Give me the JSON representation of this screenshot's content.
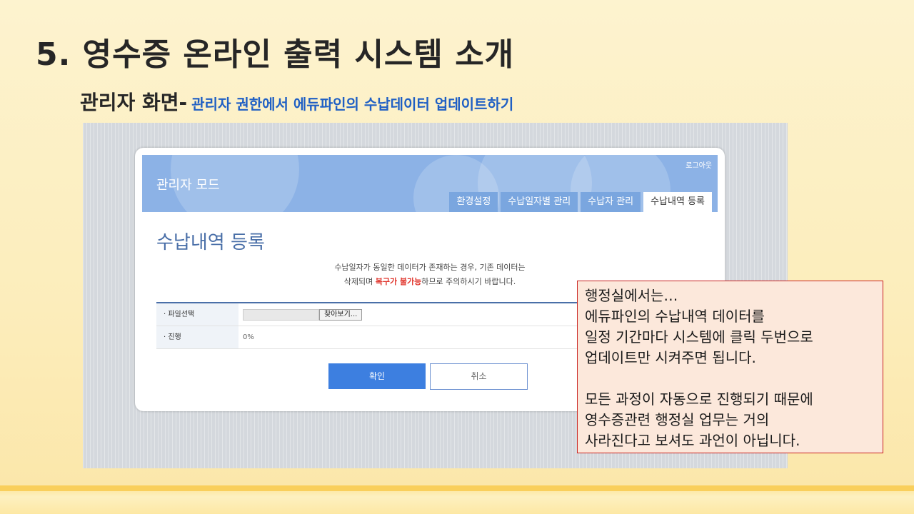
{
  "slide": {
    "title": "5. 영수증 온라인 출력 시스템 소개",
    "subtitle_lead": "관리자 화면-",
    "subtitle_desc": "관리자 권한에서 에듀파인의 수납데이터 업데이트하기"
  },
  "app": {
    "banner_title": "관리자 모드",
    "logout_label": "로그아웃",
    "tabs": [
      {
        "label": "환경설정",
        "active": false
      },
      {
        "label": "수납일자별 관리",
        "active": false
      },
      {
        "label": "수납자 관리",
        "active": false
      },
      {
        "label": "수납내역 등록",
        "active": true
      }
    ],
    "page_heading": "수납내역 등록",
    "notice": {
      "line1": "수납일자가 동일한 데이터가 존재하는 경우, 기존 데이터는",
      "line2_before": "삭제되며 ",
      "line2_highlight": "복구가 불가능",
      "line2_after": "하므로 주의하시기 바랍니다."
    },
    "form": {
      "file_label": "· 파일선택",
      "browse_button": "찾아보기...",
      "progress_label": "· 진행",
      "progress_value": "0%"
    },
    "confirm_button": "확인",
    "cancel_button": "취소"
  },
  "callout": {
    "lines": [
      "행정실에서는…",
      "에듀파인의 수납내역 데이터를",
      "일정 기간마다 시스템에 클릭 두번으로",
      "업데이트만 시켜주면 됩니다.",
      "",
      "모든 과정이 자동으로 진행되기 때문에",
      "영수증관련 행정실 업무는 거의",
      "사라진다고 보셔도 과언이 아닙니다."
    ]
  },
  "colors": {
    "banner": "#8cb2e6",
    "confirm": "#3d7fe0",
    "warning": "#e0342b",
    "subtitle_desc": "#1f5fc4",
    "callout_border": "#c9211e"
  }
}
